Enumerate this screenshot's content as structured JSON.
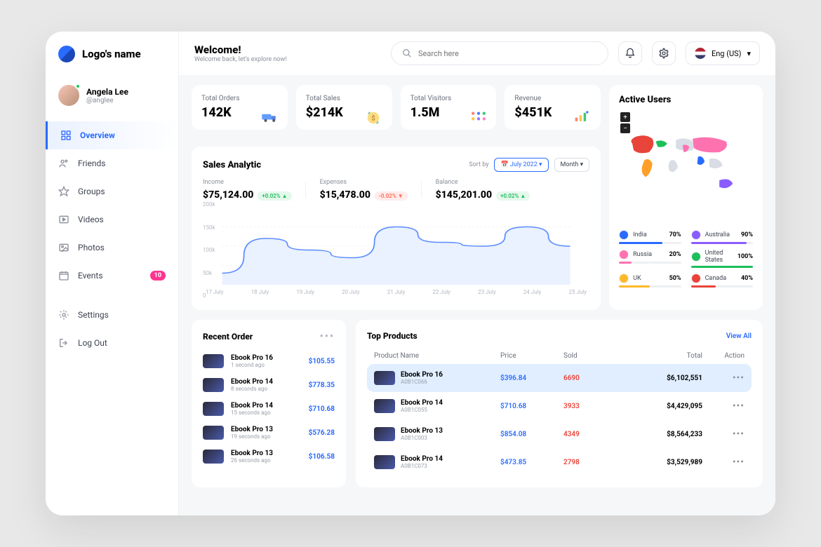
{
  "brand": "Logo's name",
  "user": {
    "name": "Angela Lee",
    "handle": "@anglee"
  },
  "nav": [
    {
      "k": "overview",
      "label": "Overview",
      "active": true
    },
    {
      "k": "friends",
      "label": "Friends"
    },
    {
      "k": "groups",
      "label": "Groups"
    },
    {
      "k": "videos",
      "label": "Videos"
    },
    {
      "k": "photos",
      "label": "Photos"
    },
    {
      "k": "events",
      "label": "Events",
      "badge": "10"
    },
    {
      "k": "settings",
      "label": "Settings"
    },
    {
      "k": "logout",
      "label": "Log Out"
    }
  ],
  "header": {
    "title": "Welcome!",
    "subtitle": "Welcome back, let's explore now!",
    "search_placeholder": "Search here",
    "lang": "Eng (US)"
  },
  "stats": [
    {
      "label": "Total Orders",
      "value": "142K"
    },
    {
      "label": "Total Sales",
      "value": "$214K"
    },
    {
      "label": "Total Visitors",
      "value": "1.5M"
    },
    {
      "label": "Revenue",
      "value": "$451K"
    }
  ],
  "active_users": {
    "title": "Active Users",
    "countries": [
      {
        "name": "India",
        "pct": "70%",
        "color": "#2a6bff"
      },
      {
        "name": "Australia",
        "pct": "90%",
        "color": "#8a5cff"
      },
      {
        "name": "Russia",
        "pct": "20%",
        "color": "#ff72b0"
      },
      {
        "name": "United States",
        "pct": "100%",
        "color": "#1dbf5a"
      },
      {
        "name": "UK",
        "pct": "50%",
        "color": "#ffb92a"
      },
      {
        "name": "Canada",
        "pct": "40%",
        "color": "#e8443a"
      }
    ]
  },
  "analytic": {
    "title": "Sales Analytic",
    "sort_label": "Sort by",
    "period": "July 2022",
    "granularity": "Month",
    "metrics": [
      {
        "key": "Income",
        "value": "$75,124.00",
        "delta": "+0.02%",
        "dir": "up"
      },
      {
        "key": "Expenses",
        "value": "$15,478.00",
        "delta": "-0.02%",
        "dir": "dn"
      },
      {
        "key": "Balance",
        "value": "$145,201.00",
        "delta": "+0.02%",
        "dir": "up"
      }
    ]
  },
  "chart_data": {
    "type": "line",
    "categories": [
      "17 July",
      "18 July",
      "19 July",
      "20 July",
      "21 July",
      "22 July",
      "23 July",
      "24 July",
      "25 July"
    ],
    "values": [
      30,
      120,
      90,
      70,
      150,
      110,
      100,
      150,
      100
    ],
    "ylabel": "",
    "xlabel": "",
    "ylim": [
      0,
      200
    ],
    "yticks": [
      "0",
      "50k",
      "100k",
      "150k",
      "200k"
    ]
  },
  "recent": {
    "title": "Recent Order",
    "items": [
      {
        "name": "Ebook Pro 16",
        "time": "1 second ago",
        "price": "$105.55"
      },
      {
        "name": "Ebook Pro 14",
        "time": "8 seconds ago",
        "price": "$778.35"
      },
      {
        "name": "Ebook Pro 14",
        "time": "15 seconds ago",
        "price": "$710.68"
      },
      {
        "name": "Ebook Pro 13",
        "time": "19 seconds ago",
        "price": "$576.28"
      },
      {
        "name": "Ebook Pro 13",
        "time": "26 seconds ago",
        "price": "$106.58"
      }
    ]
  },
  "products": {
    "title": "Top Products",
    "view_all": "View All",
    "cols": {
      "name": "Product Name",
      "price": "Price",
      "sold": "Sold",
      "total": "Total",
      "action": "Action"
    },
    "rows": [
      {
        "name": "Ebook Pro 16",
        "sku": "A0B1C066",
        "price": "$396.84",
        "sold": "6690",
        "total": "$6,102,551",
        "hl": true
      },
      {
        "name": "Ebook Pro 14",
        "sku": "A0B1C055",
        "price": "$710.68",
        "sold": "3933",
        "total": "$4,429,095"
      },
      {
        "name": "Ebook Pro 13",
        "sku": "A0B1C003",
        "price": "$854.08",
        "sold": "4349",
        "total": "$8,564,233"
      },
      {
        "name": "Ebook Pro 14",
        "sku": "A0B1C073",
        "price": "$473.85",
        "sold": "2798",
        "total": "$3,529,989"
      }
    ]
  }
}
